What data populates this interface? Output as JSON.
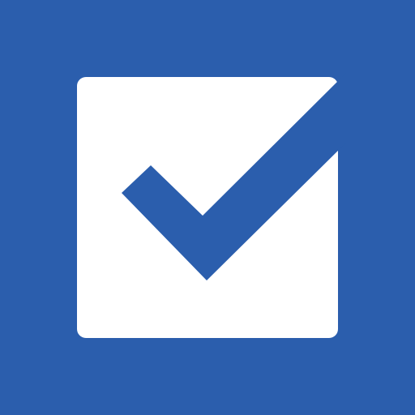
{
  "icon": {
    "name": "checkbox-checked-icon",
    "state": "checked"
  },
  "colors": {
    "background": "#2b5ead",
    "box": "#ffffff",
    "check": "#2b5ead"
  }
}
